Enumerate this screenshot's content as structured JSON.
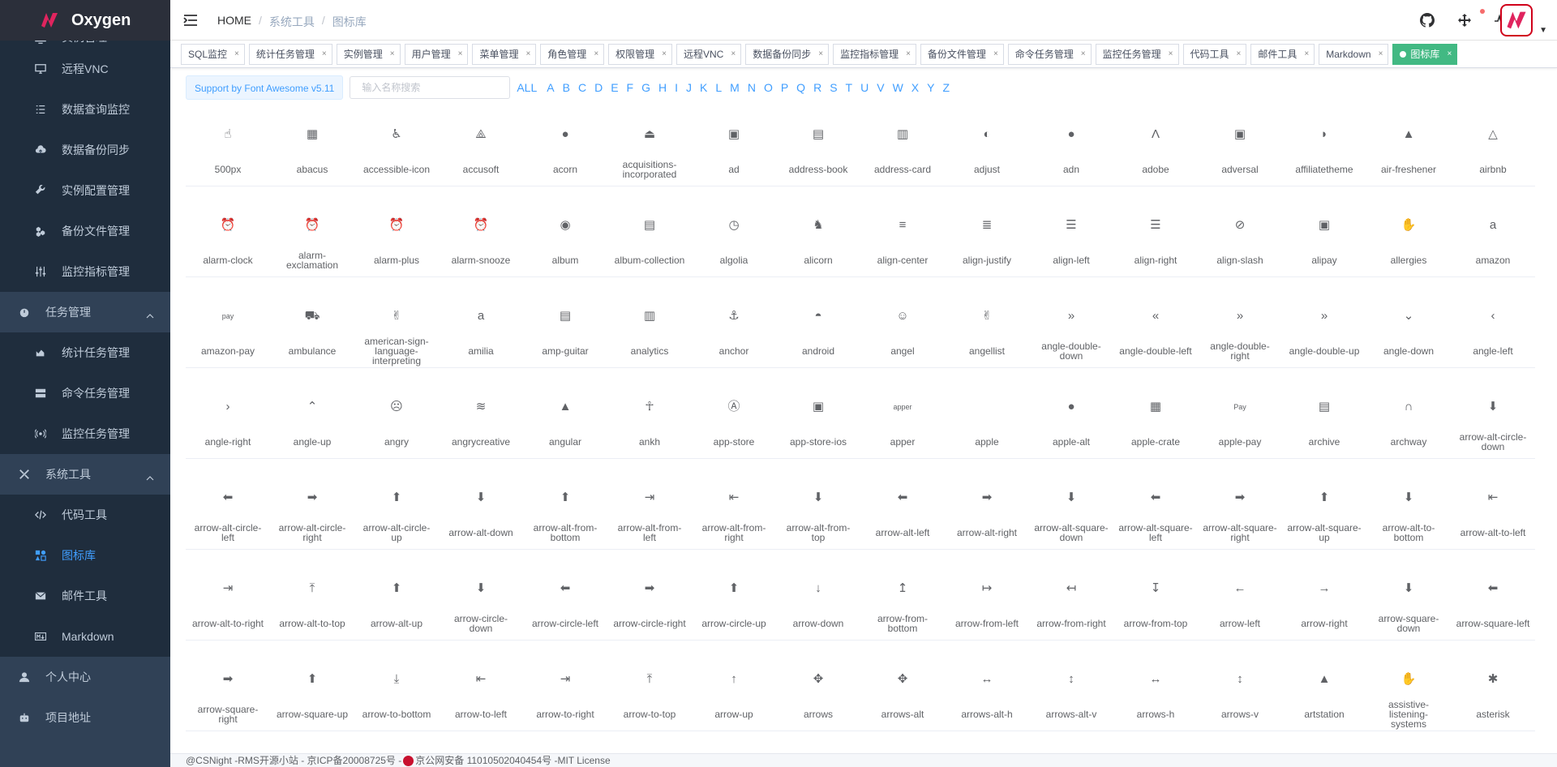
{
  "app": {
    "name": "Oxygen"
  },
  "sidebar": {
    "items": [
      {
        "label": "实例管理",
        "icon": "monitor-icon",
        "kind": "sub"
      },
      {
        "label": "远程VNC",
        "icon": "desktop-icon",
        "kind": "sub"
      },
      {
        "label": "数据查询监控",
        "icon": "list-icon",
        "kind": "sub"
      },
      {
        "label": "数据备份同步",
        "icon": "cloud-upload-icon",
        "kind": "sub"
      },
      {
        "label": "实例配置管理",
        "icon": "wrench-icon",
        "kind": "sub"
      },
      {
        "label": "备份文件管理",
        "icon": "cubes-icon",
        "kind": "sub"
      },
      {
        "label": "监控指标管理",
        "icon": "sliders-icon",
        "kind": "sub"
      },
      {
        "label": "任务管理",
        "icon": "stopwatch-icon",
        "kind": "top"
      },
      {
        "label": "统计任务管理",
        "icon": "chart-area-icon",
        "kind": "sub"
      },
      {
        "label": "命令任务管理",
        "icon": "server-icon",
        "kind": "sub"
      },
      {
        "label": "监控任务管理",
        "icon": "broadcast-icon",
        "kind": "sub"
      },
      {
        "label": "系统工具",
        "icon": "tools-icon",
        "kind": "top"
      },
      {
        "label": "代码工具",
        "icon": "code-icon",
        "kind": "sub"
      },
      {
        "label": "图标库",
        "icon": "icons-icon",
        "kind": "sub",
        "active": true
      },
      {
        "label": "邮件工具",
        "icon": "envelope-icon",
        "kind": "sub"
      },
      {
        "label": "Markdown",
        "icon": "markdown-icon",
        "kind": "sub"
      },
      {
        "label": "个人中心",
        "icon": "user-icon",
        "kind": "top"
      },
      {
        "label": "项目地址",
        "icon": "robot-icon",
        "kind": "top"
      }
    ]
  },
  "header": {
    "breadcrumb": [
      "HOME",
      "系统工具",
      "图标库"
    ]
  },
  "tags": [
    "SQL监控",
    "统计任务管理",
    "实例管理",
    "用户管理",
    "菜单管理",
    "角色管理",
    "权限管理",
    "远程VNC",
    "数据备份同步",
    "监控指标管理",
    "备份文件管理",
    "命令任务管理",
    "监控任务管理",
    "代码工具",
    "邮件工具",
    "Markdown",
    "图标库"
  ],
  "toolbar": {
    "badge": "Support by Font Awesome v5.11",
    "search_placeholder": "输入名称搜索",
    "letters": [
      "ALL",
      "A",
      "B",
      "C",
      "D",
      "E",
      "F",
      "G",
      "H",
      "I",
      "J",
      "K",
      "L",
      "M",
      "N",
      "O",
      "P",
      "Q",
      "R",
      "S",
      "T",
      "U",
      "V",
      "W",
      "X",
      "Y",
      "Z"
    ]
  },
  "icons": [
    [
      "500px",
      "abacus",
      "accessible-icon",
      "accusoft",
      "acorn",
      "acquisitions-incorporated",
      "ad",
      "address-book",
      "address-card",
      "adjust",
      "adn",
      "adobe",
      "adversal",
      "affiliatetheme",
      "air-freshener",
      "airbnb"
    ],
    [
      "alarm-clock",
      "alarm-exclamation",
      "alarm-plus",
      "alarm-snooze",
      "album",
      "album-collection",
      "algolia",
      "alicorn",
      "align-center",
      "align-justify",
      "align-left",
      "align-right",
      "align-slash",
      "alipay",
      "allergies",
      "amazon"
    ],
    [
      "amazon-pay",
      "ambulance",
      "american-sign-language-interpreting",
      "amilia",
      "amp-guitar",
      "analytics",
      "anchor",
      "android",
      "angel",
      "angellist",
      "angle-double-down",
      "angle-double-left",
      "angle-double-right",
      "angle-double-up",
      "angle-down",
      "angle-left"
    ],
    [
      "angle-right",
      "angle-up",
      "angry",
      "angrycreative",
      "angular",
      "ankh",
      "app-store",
      "app-store-ios",
      "apper",
      "apple",
      "apple-alt",
      "apple-crate",
      "apple-pay",
      "archive",
      "archway",
      "arrow-alt-circle-down"
    ],
    [
      "arrow-alt-circle-left",
      "arrow-alt-circle-right",
      "arrow-alt-circle-up",
      "arrow-alt-down",
      "arrow-alt-from-bottom",
      "arrow-alt-from-left",
      "arrow-alt-from-right",
      "arrow-alt-from-top",
      "arrow-alt-left",
      "arrow-alt-right",
      "arrow-alt-square-down",
      "arrow-alt-square-left",
      "arrow-alt-square-right",
      "arrow-alt-square-up",
      "arrow-alt-to-bottom",
      "arrow-alt-to-left"
    ],
    [
      "arrow-alt-to-right",
      "arrow-alt-to-top",
      "arrow-alt-up",
      "arrow-circle-down",
      "arrow-circle-left",
      "arrow-circle-right",
      "arrow-circle-up",
      "arrow-down",
      "arrow-from-bottom",
      "arrow-from-left",
      "arrow-from-right",
      "arrow-from-top",
      "arrow-left",
      "arrow-right",
      "arrow-square-down",
      "arrow-square-left"
    ],
    [
      "arrow-square-right",
      "arrow-square-up",
      "arrow-to-bottom",
      "arrow-to-left",
      "arrow-to-right",
      "arrow-to-top",
      "arrow-up",
      "arrows",
      "arrows-alt",
      "arrows-alt-h",
      "arrows-alt-v",
      "arrows-h",
      "arrows-v",
      "artstation",
      "assistive-listening-systems",
      "asterisk"
    ]
  ],
  "glyphs": [
    [
      "☝",
      "▦",
      "♿",
      "⟁",
      "●",
      "⏏",
      "▣",
      "▤",
      "▥",
      "◐",
      "●",
      "Λ",
      "▣",
      "◗",
      "▲",
      "△"
    ],
    [
      "⏰",
      "⏰",
      "⏰",
      "⏰",
      "◉",
      "▤",
      "◷",
      "♞",
      "≡",
      "≣",
      "☰",
      "☰",
      "⊘",
      "▣",
      "✋",
      "a"
    ],
    [
      "pay",
      "⛟",
      "✌",
      "a",
      "▤",
      "▥",
      "⚓",
      "◓",
      "☺",
      "✌",
      "»",
      "«",
      "»",
      "»",
      "⌄",
      "‹"
    ],
    [
      "›",
      "⌃",
      "☹",
      "≋",
      "▲",
      "☥",
      "Ⓐ",
      "▣",
      "apper",
      "",
      "●",
      "▦",
      "Pay",
      "▤",
      "∩",
      "⬇"
    ],
    [
      "⬅",
      "➡",
      "⬆",
      "⬇",
      "⬆",
      "⇥",
      "⇤",
      "⬇",
      "⬅",
      "➡",
      "⬇",
      "⬅",
      "➡",
      "⬆",
      "⬇",
      "⇤"
    ],
    [
      "⇥",
      "⤒",
      "⬆",
      "⬇",
      "⬅",
      "➡",
      "⬆",
      "↓",
      "↥",
      "↦",
      "↤",
      "↧",
      "←",
      "→",
      "⬇",
      "⬅"
    ],
    [
      "➡",
      "⬆",
      "⤓",
      "⇤",
      "⇥",
      "⤒",
      "↑",
      "✥",
      "✥",
      "↔",
      "↕",
      "↔",
      "↕",
      "▲",
      "✋",
      "✱"
    ]
  ],
  "footer": {
    "left": "@CSNight -RMS开源小站 - 京ICP备20008725号 -",
    "right": "京公网安备 11010502040454号 -MIT License"
  },
  "colors": {
    "sidebar_bg": "#304156",
    "submenu_bg": "#1f2d3d",
    "accent": "#409eff",
    "active_tag": "#42b983"
  }
}
